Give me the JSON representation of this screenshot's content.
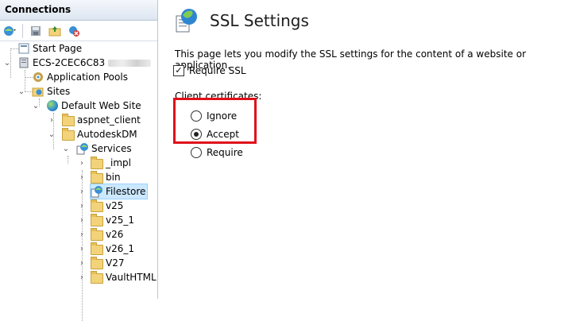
{
  "connections": {
    "title": "Connections",
    "toolbar": [
      {
        "icon": "connect-globe-icon"
      },
      {
        "icon": "save-icon"
      },
      {
        "icon": "up-folder-icon"
      },
      {
        "icon": "disconnect-icon"
      }
    ]
  },
  "tree": {
    "start_page": "Start Page",
    "server": "ECS-2CEC6C83",
    "application_pools": "Application Pools",
    "sites": "Sites",
    "default_web_site": "Default Web Site",
    "aspnet_client": "aspnet_client",
    "autodeskdm": "AutodeskDM",
    "services": "Services",
    "children": [
      "_impl",
      "bin",
      "Filestore",
      "v25",
      "v25_1",
      "v26",
      "v26_1",
      "V27",
      "VaultHTML"
    ],
    "selected": "Filestore"
  },
  "ssl": {
    "title": "SSL Settings",
    "description": "This page lets you modify the SSL settings for the content of a website or application.",
    "require_ssl_label": "Require SSL",
    "require_ssl_checked": true,
    "client_certificates_label": "Client certificates:",
    "options": [
      "Ignore",
      "Accept",
      "Require"
    ],
    "selected_option": "Accept"
  },
  "colors": {
    "highlight": "#e0101a",
    "selection": "#cce8ff"
  }
}
